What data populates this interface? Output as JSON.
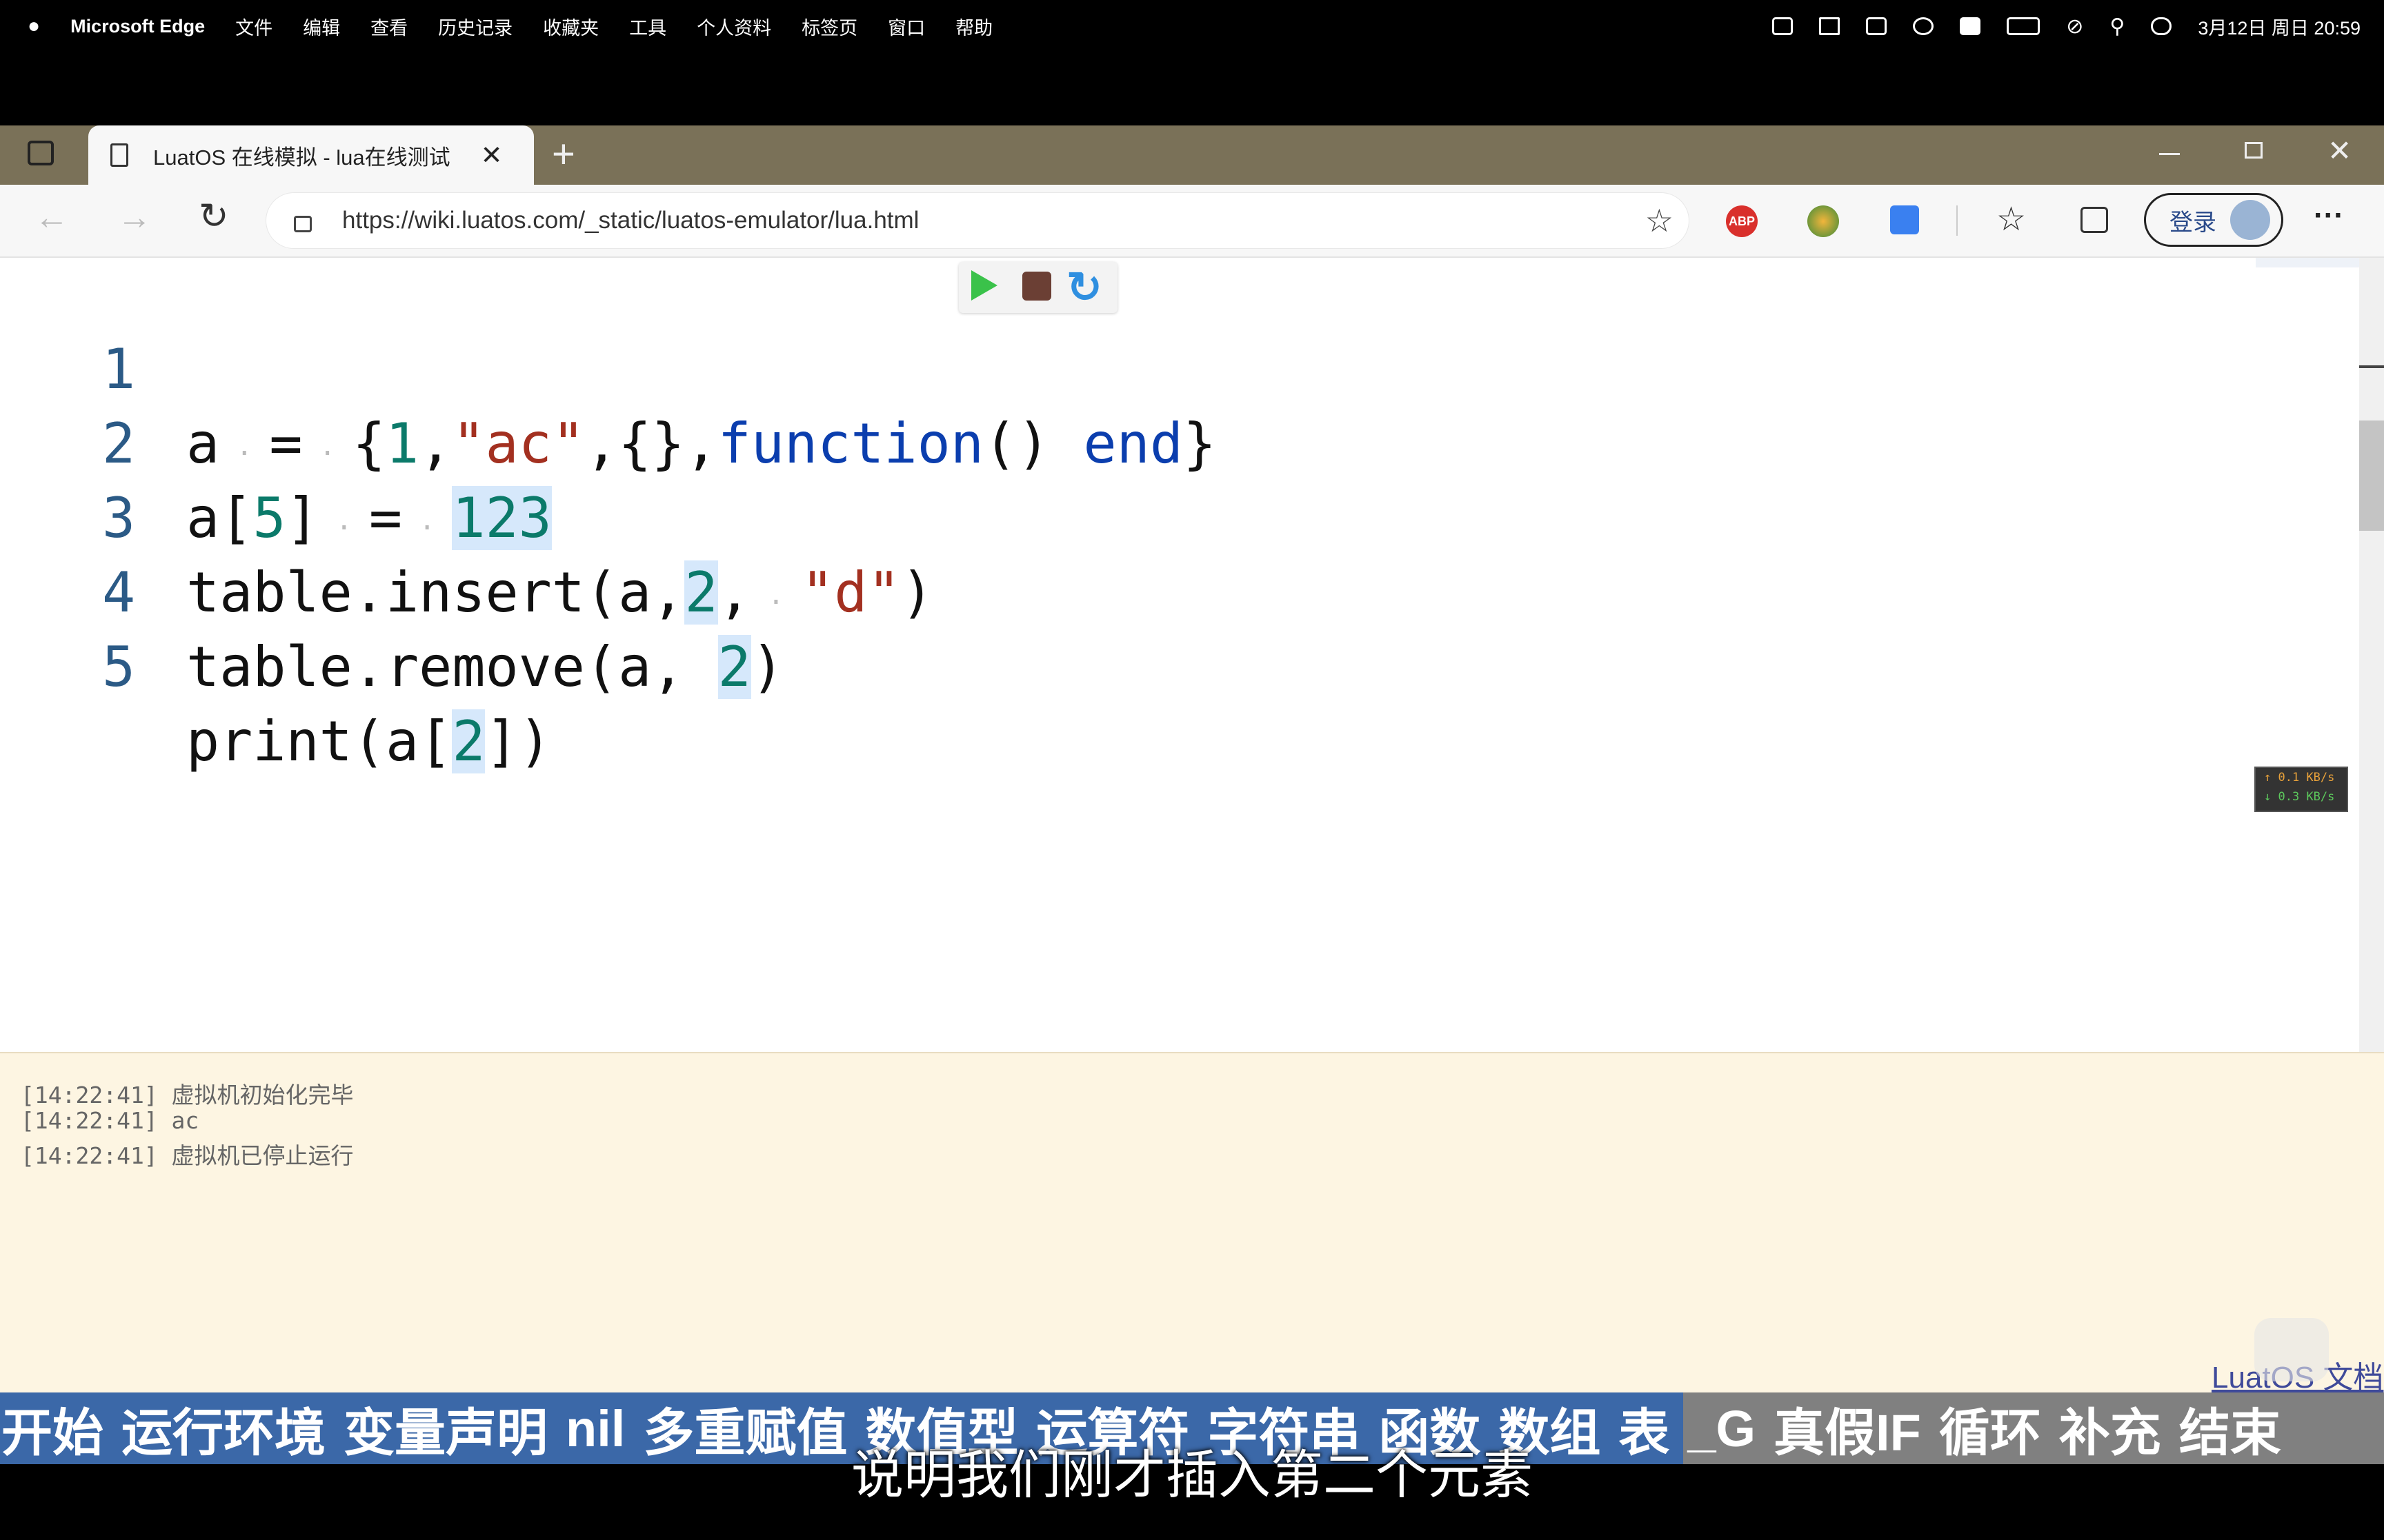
{
  "menubar": {
    "app_name": "Microsoft Edge",
    "items": [
      "文件",
      "编辑",
      "查看",
      "历史记录",
      "收藏夹",
      "工具",
      "个人资料",
      "标签页",
      "窗口",
      "帮助"
    ],
    "datetime": "3月12日 周日 20:59"
  },
  "browser": {
    "tab_title": "LuatOS 在线模拟 - lua在线测试",
    "new_tab": "+",
    "url": "https://wiki.luatos.com/_static/luatos-emulator/lua.html",
    "signin_label": "登录",
    "more": "···",
    "adblock": "ABP"
  },
  "editor": {
    "lines": [
      {
        "n": "1"
      },
      {
        "n": "2"
      },
      {
        "n": "3"
      },
      {
        "n": "4"
      },
      {
        "n": "5"
      }
    ],
    "tokens": {
      "l1": [
        "a",
        " = ",
        "{",
        "1",
        ",",
        "\"ac\"",
        ",{},",
        "function",
        "() ",
        "end",
        "}"
      ],
      "l2": [
        "a[",
        "5",
        "] = ",
        "123"
      ],
      "l3": [
        "table.insert(a,",
        "2",
        ", ",
        "\"d\"",
        ")"
      ],
      "l4": [
        "table.remove(a, ",
        "2",
        ")"
      ],
      "l5": [
        "print(a[",
        "2",
        "])"
      ]
    }
  },
  "net_monitor": {
    "up": "↑ 0.1 KB/s",
    "down": "↓ 0.3 KB/s"
  },
  "console": {
    "lines": [
      "[14:22:41] 虚拟机初始化完毕",
      "[14:22:41] ac",
      "[14:22:41] 虚拟机已停止运行"
    ]
  },
  "docs_link": "LuatOS 文档",
  "bottom_nav": [
    "开始",
    "运行环境",
    "变量声明",
    "nil",
    "多重赋值",
    "数值型",
    "运算符",
    "字符串",
    "函数",
    "数组",
    "表",
    "_G",
    "真假IF",
    "循环",
    "补充",
    "结束"
  ],
  "subtitle": "说明我们刚才插入第二个元素"
}
